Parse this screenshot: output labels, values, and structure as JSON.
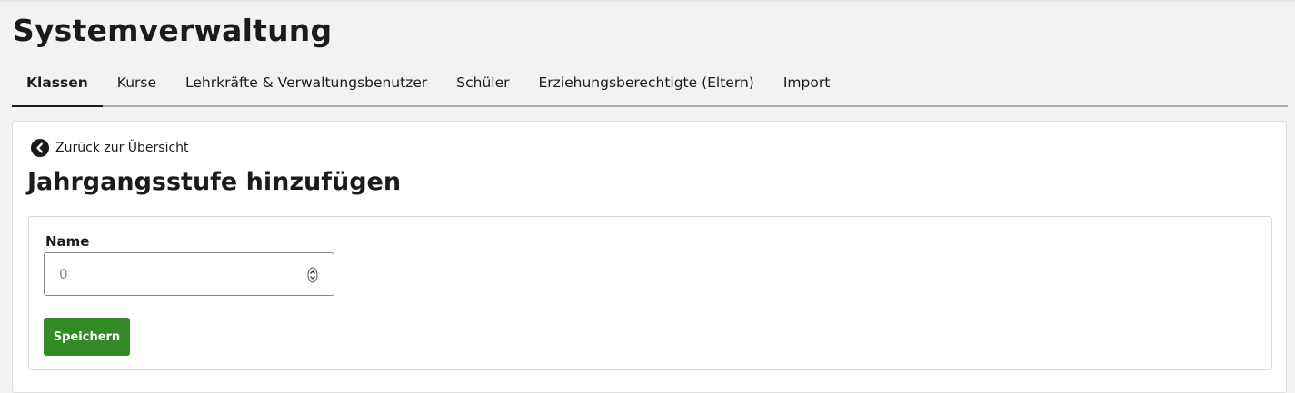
{
  "page": {
    "title": "Systemverwaltung"
  },
  "tabs": [
    {
      "label": "Klassen",
      "active": true
    },
    {
      "label": "Kurse",
      "active": false
    },
    {
      "label": "Lehrkräfte & Verwaltungsbenutzer",
      "active": false
    },
    {
      "label": "Schüler",
      "active": false
    },
    {
      "label": "Erziehungsberechtigte (Eltern)",
      "active": false
    },
    {
      "label": "Import",
      "active": false
    }
  ],
  "card": {
    "back_link": {
      "label": "Zurück zur Übersicht",
      "icon": "chevron-left-circle-icon"
    },
    "heading": "Jahrgangsstufe hinzufügen",
    "form": {
      "name_label": "Name",
      "name_placeholder": "0",
      "name_value": "",
      "save_label": "Speichern"
    }
  },
  "colors": {
    "background": "#f2f2f2",
    "card": "#ffffff",
    "text": "#1b1b1b",
    "primary_button": "#338a27",
    "tab_border": "#a9a9a9"
  }
}
